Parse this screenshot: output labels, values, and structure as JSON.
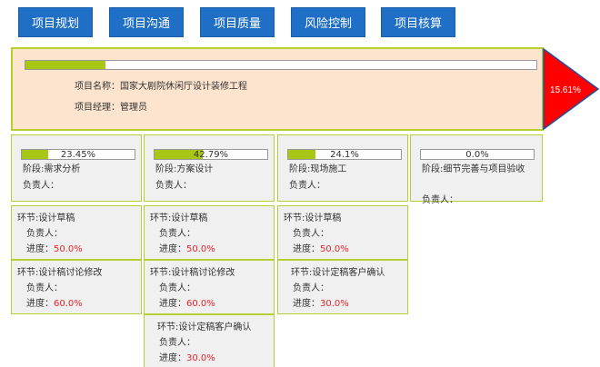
{
  "tabs": [
    {
      "label": "项目规划"
    },
    {
      "label": "项目沟通"
    },
    {
      "label": "项目质量"
    },
    {
      "label": "风险控制"
    },
    {
      "label": "项目核算"
    }
  ],
  "project": {
    "name_label": "项目名称：国家大剧院休闲厅设计装修工程",
    "manager_label": "项目经理：管理员",
    "progress": 15.61,
    "progress_text": "15.61%"
  },
  "stages": [
    {
      "progress": 23.45,
      "progress_text": "23.45%",
      "name": "阶段:需求分析",
      "owner": "负责人："
    },
    {
      "progress": 42.79,
      "progress_text": "42.79%",
      "name": "阶段:方案设计",
      "owner": "负责人："
    },
    {
      "progress": 24.1,
      "progress_text": "24.1%",
      "name": "阶段:现场施工",
      "owner": "负责人："
    },
    {
      "progress": 0.0,
      "progress_text": "0.0%",
      "name": "阶段:细节完善与项目验收",
      "owner": "负责人："
    }
  ],
  "steps": [
    [
      {
        "name": "环节:设计草稿",
        "owner": "负责人：",
        "progress_label": "进度：",
        "progress_value": "50.0%"
      },
      {
        "name": "环节:设计稿讨论修改",
        "owner": "负责人：",
        "progress_label": "进度：",
        "progress_value": "60.0%"
      }
    ],
    [
      {
        "name": "环节:设计草稿",
        "owner": "负责人：",
        "progress_label": "进度：",
        "progress_value": "50.0%"
      },
      {
        "name": "环节:设计稿讨论修改",
        "owner": "负责人：",
        "progress_label": "进度：",
        "progress_value": "60.0%"
      },
      {
        "name": "环节:设计定稿客户确认",
        "owner": "负责人：",
        "progress_label": "进度：",
        "progress_value": "30.0%"
      }
    ],
    [
      {
        "name": "环节:设计草稿",
        "owner": "负责人：",
        "progress_label": "进度：",
        "progress_value": "50.0%"
      },
      {
        "name": "环节:设计定稿客户确认",
        "owner": "负责人：",
        "progress_label": "进度：",
        "progress_value": "30.0%"
      }
    ]
  ],
  "colors": {
    "tab_bg": "#1f6fc6",
    "panel_bg": "#fde4cf",
    "border_green": "#b7cf32",
    "bar_fill": "#a8c614",
    "arrow_red": "#ff0000",
    "arrow_border": "#1f4fa0",
    "progress_red": "#e8242a"
  }
}
